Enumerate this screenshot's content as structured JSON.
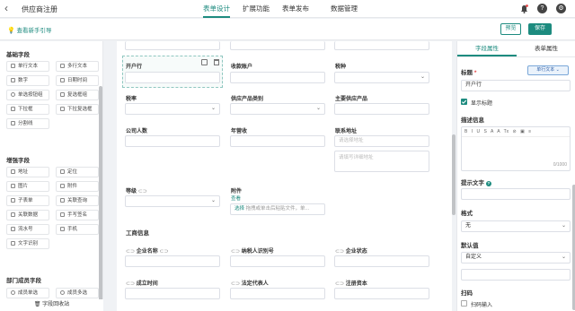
{
  "header": {
    "back_icon": "chevron-left-icon",
    "title": "供应商注册",
    "tabs": [
      "表单设计",
      "扩展功能",
      "表单发布",
      "数据管理"
    ],
    "icons": [
      "bell-icon",
      "help-icon",
      "gear-icon"
    ]
  },
  "subbar": {
    "guide": "查看新手引导",
    "preview": "预览",
    "save": "保存"
  },
  "left_panel": {
    "basic_title": "基础字段",
    "basic": [
      "单行文本",
      "多行文本",
      "数字",
      "日期时间",
      "单选按钮组",
      "复选框组",
      "下拉框",
      "下拉复选框",
      "分割线"
    ],
    "enhanced_title": "增强字段",
    "enhanced": [
      "地址",
      "定位",
      "图片",
      "附件",
      "子表单",
      "关联查询",
      "关联数据",
      "手写签名",
      "流水号",
      "手机",
      "文字识别"
    ],
    "member_title": "部门成员字段",
    "member": [
      "成员单选",
      "成员多选"
    ],
    "recycle": "字段回收站"
  },
  "canvas": {
    "fields": {
      "supplier_bank": "开户行",
      "account": "收款账户",
      "tax_type": "税种",
      "tax_rate": "税率",
      "category": "供应产品类别",
      "main_product": "主要供应产品",
      "headcount": "公司人数",
      "revenue": "年营收",
      "contact_address": "联系地址",
      "level": "等级",
      "attachment": "附件"
    },
    "address_placeholder": "请选择地址",
    "address_detail_placeholder": "请填写详细地址",
    "attachment_view": "查看",
    "attachment_select": "选择",
    "attachment_hint": "拖拽或单击后粘贴文件，单...",
    "section_title": "工商信息",
    "biz_fields": [
      "企业名称",
      "纳税人识别号",
      "企业状态",
      "成立时间",
      "法定代表人",
      "注册资本"
    ]
  },
  "right_panel": {
    "tabs": [
      "字段属性",
      "表单属性"
    ],
    "title_label": "标题",
    "field_type": "单行文本",
    "title_value": "开户行",
    "show_title": "显示标题",
    "description_label": "描述信息",
    "editor_tools": [
      "B",
      "I",
      "U",
      "S",
      "A",
      "A",
      "Tx",
      "link",
      "image",
      "list"
    ],
    "counter": "0/1000",
    "hint_label": "提示文字",
    "format_label": "格式",
    "format_value": "无",
    "default_label": "默认值",
    "default_value": "自定义",
    "scan_label": "扫码",
    "scan_input": "扫码输入"
  },
  "colors": {
    "accent": "#1d8b7f"
  }
}
